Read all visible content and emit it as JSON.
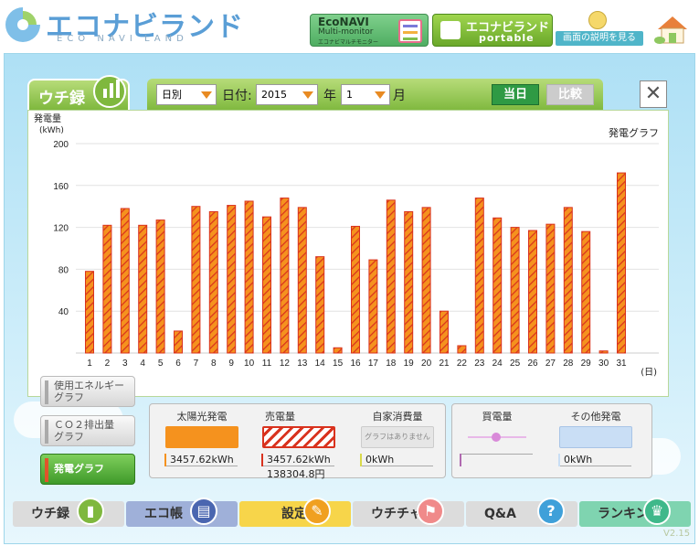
{
  "header": {
    "logo_title": "エコナビランド",
    "logo_subtitle": "ECO NAVI LAND",
    "econavi_btn": {
      "line1": "EcoNAVI",
      "line2": "Multi-monitor",
      "line3": "エコナビマルチモニター"
    },
    "portable_btn": {
      "line1": "エコナビランド",
      "line2": "portable"
    },
    "help_label": "画面の説明を見る"
  },
  "tab": {
    "label": "ウチ録"
  },
  "toolbar": {
    "period_value": "日別",
    "date_label": "日付:",
    "year_value": "2015",
    "year_label": "年",
    "month_value": "1",
    "month_label": "月",
    "today_label": "当日",
    "compare_label": "比較",
    "close_icon": "close-icon"
  },
  "chart_data": {
    "type": "bar",
    "title": "発電グラフ",
    "ylabel": "発電量\n(kWh)",
    "xlabel": "(日)",
    "ylim": [
      0,
      200
    ],
    "yticks": [
      40,
      80,
      120,
      160,
      200
    ],
    "categories": [
      "1",
      "2",
      "3",
      "4",
      "5",
      "6",
      "7",
      "8",
      "9",
      "10",
      "11",
      "12",
      "13",
      "14",
      "15",
      "16",
      "17",
      "18",
      "19",
      "20",
      "21",
      "22",
      "23",
      "24",
      "25",
      "26",
      "27",
      "28",
      "29",
      "30",
      "31"
    ],
    "values": [
      78,
      122,
      138,
      122,
      127,
      21,
      140,
      135,
      141,
      145,
      130,
      148,
      139,
      92,
      5,
      121,
      89,
      146,
      135,
      139,
      40,
      7,
      148,
      129,
      120,
      117,
      123,
      139,
      116,
      2,
      172
    ],
    "bar_color": "#f5921e",
    "hatch_color": "#d9321e",
    "grid": true
  },
  "side_buttons": [
    {
      "label": "使用エネルギー\nグラフ",
      "active": false
    },
    {
      "label": "ＣＯ２排出量\nグラフ",
      "active": false
    },
    {
      "label": "発電グラフ",
      "active": true
    }
  ],
  "legend": {
    "solar": {
      "name": "太陽光発電",
      "value": "3457.62kWh",
      "color": "#f5921e"
    },
    "sold": {
      "name": "売電量",
      "value": "3457.62kWh",
      "value2": "138304.8円",
      "color": "#d9321e"
    },
    "self": {
      "name": "自家消費量",
      "swatch_text": "グラフはありません",
      "value": "0kWh",
      "color": "#d9d94a"
    },
    "bought": {
      "name": "買電量",
      "value": "",
      "color": "#b069b0"
    },
    "other": {
      "name": "その他発電",
      "value": "0kWh",
      "color": "#c9def5"
    }
  },
  "bottom_nav": [
    {
      "label": "ウチ録",
      "bg": "#dcdcdc",
      "icon": "bar-chart-icon",
      "icon_color": "#7fb83e"
    },
    {
      "label": "エコ帳",
      "bg": "#9fb0d9",
      "icon": "notebook-icon",
      "icon_color": "#4a66b0"
    },
    {
      "label": "設定",
      "bg": "#f7d54a",
      "icon": "wrench-icon",
      "icon_color": "#f0a020"
    },
    {
      "label": "ウチチャレ",
      "bg": "#dcdcdc",
      "icon": "flag-icon",
      "icon_color": "#f08a8a"
    },
    {
      "label": "Q&A",
      "bg": "#dcdcdc",
      "icon": "question-icon",
      "icon_color": "#3fa0d9"
    },
    {
      "label": "ランキング",
      "bg": "#7fd4b0",
      "icon": "crown-icon",
      "icon_color": "#3fb88a"
    }
  ],
  "version": "V2.15"
}
